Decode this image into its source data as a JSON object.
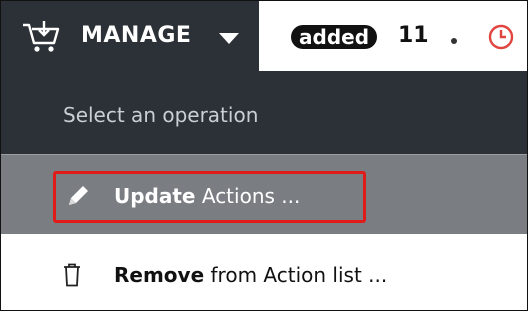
{
  "header": {
    "manage_label": "MANAGE",
    "badge_label": "added",
    "count": "11",
    "separator": "•"
  },
  "menu": {
    "prompt": "Select an operation",
    "items": [
      {
        "bold": "Update",
        "rest": " Actions ...",
        "icon": "pencil-icon"
      },
      {
        "bold": "Remove",
        "rest": " from Action list ...",
        "icon": "trash-icon"
      }
    ]
  },
  "colors": {
    "dark_panel": "#2b3136",
    "selected_row": "#7a7e82",
    "highlight": "#e11a1a",
    "clock": "#e0453f"
  }
}
